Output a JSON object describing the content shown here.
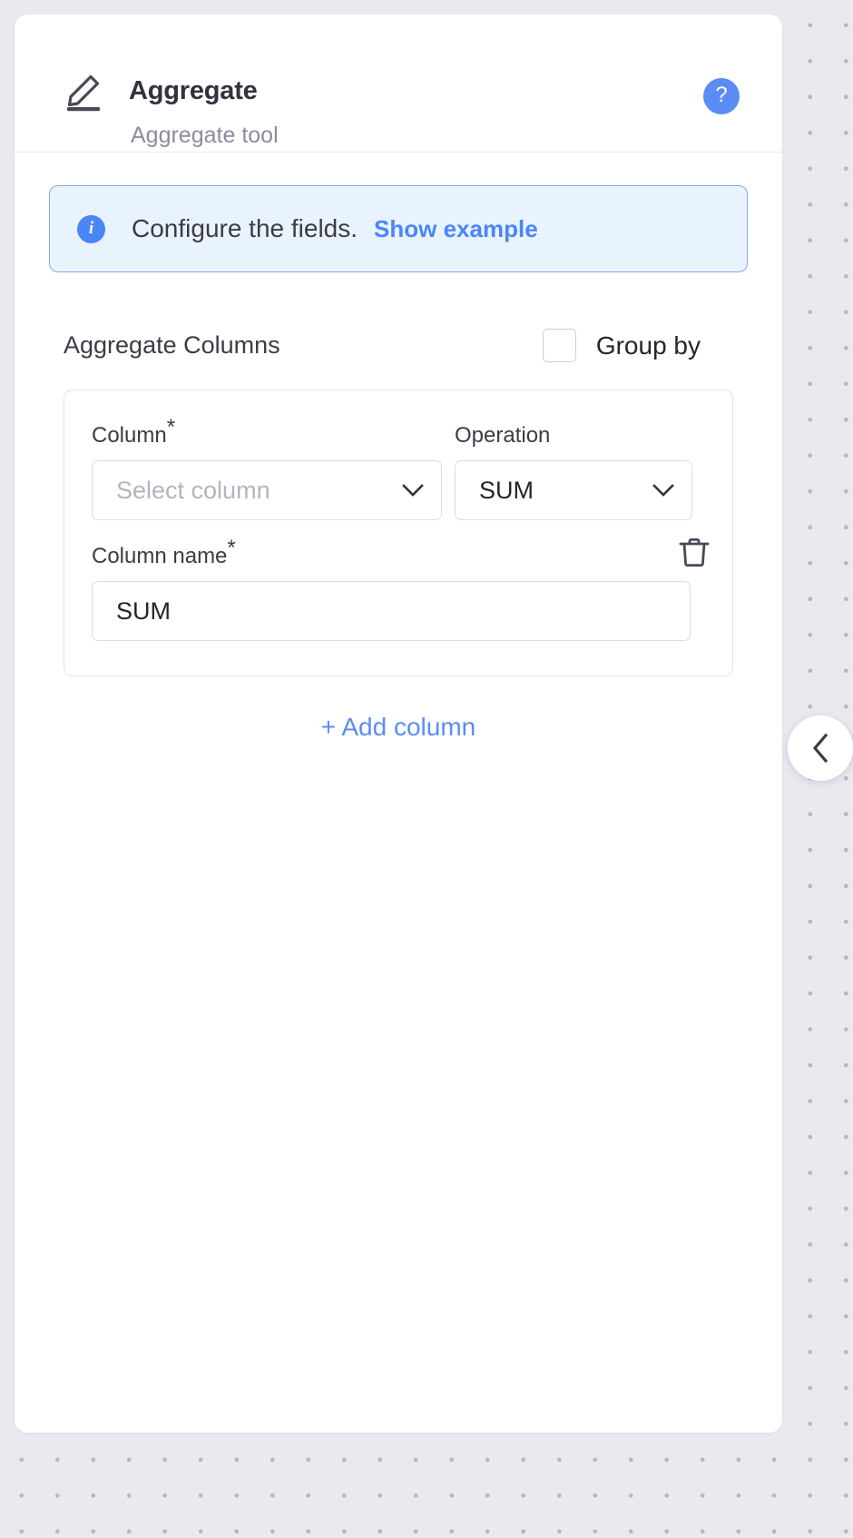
{
  "header": {
    "icon": "pencil-edit-icon",
    "title": "Aggregate",
    "subtitle": "Aggregate tool",
    "help_label": "?"
  },
  "info_banner": {
    "icon": "info-icon",
    "message": "Configure the fields.",
    "link_label": "Show example"
  },
  "section": {
    "label": "Aggregate Columns",
    "group_by_label": "Group by",
    "group_by_checked": false
  },
  "column_entry": {
    "column_label": "Column",
    "column_required_marker": "*",
    "column_value": "Select column",
    "column_placeholder": "Select column",
    "operation_label": "Operation",
    "operation_value": "SUM",
    "column_name_label": "Column name",
    "column_name_required_marker": "*",
    "column_name_value": "SUM",
    "delete_icon": "trash-icon"
  },
  "actions": {
    "add_column_label": "+ Add column",
    "collapse_icon": "chevron-left-icon"
  },
  "colors": {
    "accent_blue": "#5b8cf5",
    "info_bg": "#e9f3fe",
    "info_border": "#7fa9ef",
    "text_dark": "#33313d",
    "text_muted": "#8e8ba0",
    "page_bg": "#ebe8f0",
    "card_bg": "#ffffff",
    "border": "#e3e1e8"
  }
}
